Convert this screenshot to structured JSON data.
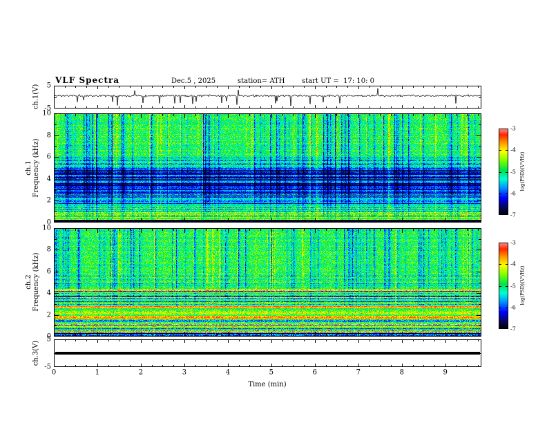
{
  "header": {
    "title": "VLF Spectra",
    "date": "Dec.5 , 2025",
    "station": "station= ATH",
    "start_ut": "start UT =  17: 10: 0"
  },
  "chart_data": {
    "type": "heatmap",
    "title": "VLF Spectra",
    "x_axis": {
      "label": "Time (min)",
      "min": 0,
      "max": 9.83,
      "ticks": [
        0,
        1,
        2,
        3,
        4,
        5,
        6,
        7,
        8,
        9
      ]
    },
    "colorbar": {
      "label": "log(PSD)(V²/Hz)",
      "min": -7,
      "max": -3,
      "ticks": [
        -3,
        -4,
        -5,
        -6,
        -7
      ]
    },
    "panels": [
      {
        "id": "ch1-wave",
        "type": "line",
        "ylabel": "ch.1(V)",
        "y_min": -5,
        "y_max": 5,
        "y_ticks": [
          5,
          -5
        ],
        "mean": 0.6,
        "sd": 0.45,
        "seed": 11
      },
      {
        "id": "ch1-spec",
        "type": "spectrogram",
        "ylabel": "ch.1\nFrequency (kHz)",
        "f_min": 0,
        "f_max": 10,
        "y_ticks": [
          0,
          2,
          4,
          6,
          8,
          10
        ],
        "seed": 42,
        "bands": [
          {
            "f0": 0.0,
            "f1": 0.25,
            "base": 0.05,
            "noise": 0.04,
            "streak": 0.05,
            "stripe": 0.05
          },
          {
            "f0": 0.25,
            "f1": 0.6,
            "base": 0.56,
            "noise": 0.1,
            "streak": 0.2,
            "stripe": 0.16,
            "speckle": 0.01
          },
          {
            "f0": 0.6,
            "f1": 1.3,
            "base": 0.47,
            "noise": 0.12,
            "streak": 0.3,
            "stripe": 0.2,
            "speckle": 0.004
          },
          {
            "f0": 1.3,
            "f1": 2.6,
            "base": 0.37,
            "noise": 0.1,
            "streak": 0.35,
            "stripe": 0.22
          },
          {
            "f0": 2.6,
            "f1": 5.0,
            "base": 0.21,
            "noise": 0.09,
            "streak": 0.35,
            "stripe": 0.16
          },
          {
            "f0": 5.0,
            "f1": 6.2,
            "base": 0.42,
            "noise": 0.12,
            "streak": 0.5,
            "stripe": 0.1
          },
          {
            "f0": 6.2,
            "f1": 10.01,
            "base": 0.53,
            "noise": 0.13,
            "streak": 0.6,
            "stripe": 0.05
          }
        ]
      },
      {
        "id": "ch2-spec",
        "type": "spectrogram",
        "ylabel": "ch.2\nFrequency (kHz)",
        "f_min": 0,
        "f_max": 10,
        "y_ticks": [
          0,
          2,
          4,
          6,
          8,
          10
        ],
        "seed": 77,
        "bands": [
          {
            "f0": 0.0,
            "f1": 0.3,
            "base": 0.34,
            "noise": 0.18,
            "streak": 0.15,
            "stripe": 0.3,
            "speckle": 0.012
          },
          {
            "f0": 0.3,
            "f1": 0.9,
            "base": 0.56,
            "noise": 0.13,
            "streak": 0.15,
            "stripe": 0.3,
            "speckle": 0.005
          },
          {
            "f0": 0.9,
            "f1": 1.7,
            "base": 0.62,
            "noise": 0.12,
            "streak": 0.15,
            "stripe": 0.32,
            "speckle": 0.005
          },
          {
            "f0": 1.7,
            "f1": 2.8,
            "base": 0.66,
            "noise": 0.11,
            "streak": 0.15,
            "stripe": 0.3,
            "speckle": 0.004
          },
          {
            "f0": 2.8,
            "f1": 4.4,
            "base": 0.52,
            "noise": 0.12,
            "streak": 0.25,
            "stripe": 0.28
          },
          {
            "f0": 4.4,
            "f1": 5.6,
            "base": 0.48,
            "noise": 0.12,
            "streak": 0.45,
            "stripe": 0.12
          },
          {
            "f0": 5.6,
            "f1": 10.01,
            "base": 0.53,
            "noise": 0.13,
            "streak": 0.55,
            "stripe": 0.05
          }
        ]
      },
      {
        "id": "ch3-wave",
        "type": "flat",
        "ylabel": "ch.3(V)",
        "y_min": -5,
        "y_max": 5,
        "y_ticks": [
          5,
          -5
        ],
        "value": 0
      }
    ]
  }
}
